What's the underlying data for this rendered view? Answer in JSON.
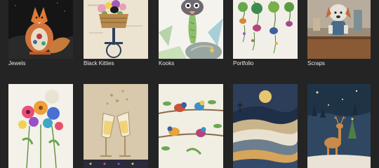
{
  "theme": {
    "background": "#242424",
    "label_color": "#e8e8e8"
  },
  "gallery": {
    "collections": [
      {
        "title": "Jewels",
        "artwork": "fox-artwork"
      },
      {
        "title": "Black Kitties",
        "artwork": "bicycle-basket-artwork"
      },
      {
        "title": "Kooks",
        "artwork": "ostrich-artwork"
      },
      {
        "title": "Portfolio",
        "artwork": "hanging-plants-artwork"
      },
      {
        "title": "Scraps",
        "artwork": "dog-figure-artwork"
      }
    ],
    "row_two": [
      {
        "artwork": "flower-bouquet-artwork"
      },
      {
        "artwork": "champagne-glasses-artwork"
      },
      {
        "artwork": "birds-on-branches-artwork"
      },
      {
        "artwork": "moonlit-hills-artwork"
      },
      {
        "artwork": "night-deer-artwork"
      }
    ]
  }
}
